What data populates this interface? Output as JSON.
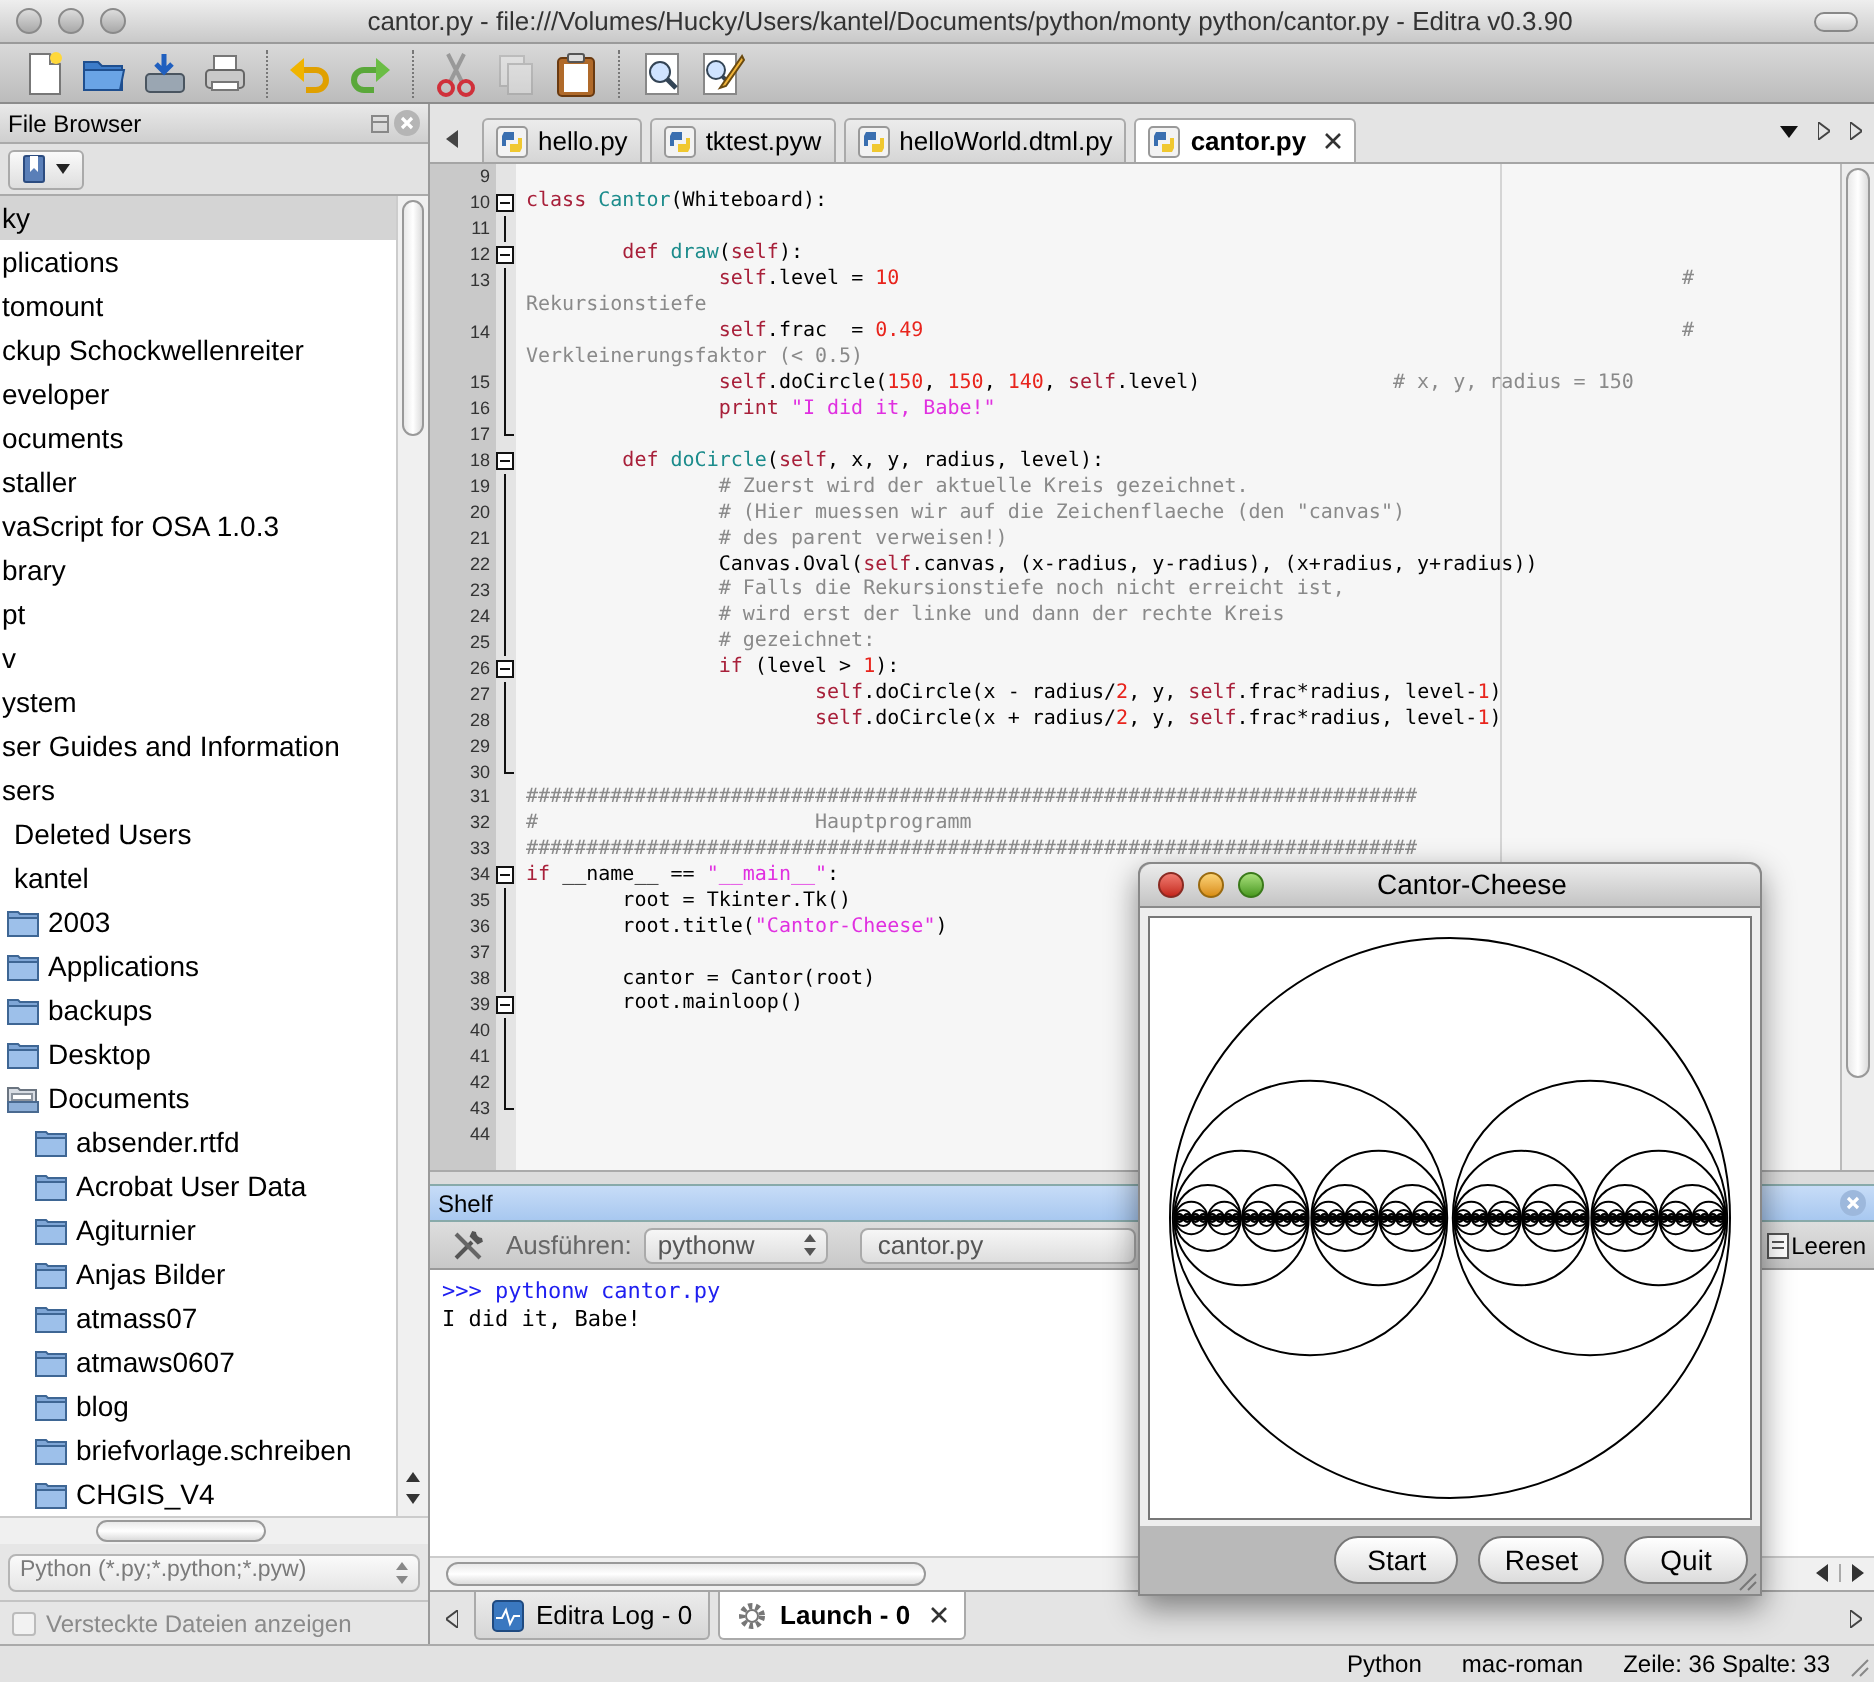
{
  "window": {
    "title": "cantor.py - file:///Volumes/Hucky/Users/kantel/Documents/python/monty python/cantor.py - Editra v0.3.90"
  },
  "toolbar": [
    [
      {
        "kind": "new",
        "disabled": false
      },
      {
        "kind": "open",
        "disabled": false
      },
      {
        "kind": "save",
        "disabled": false
      },
      {
        "kind": "print",
        "disabled": false
      }
    ],
    [
      {
        "kind": "undo",
        "disabled": false
      },
      {
        "kind": "redo",
        "disabled": false
      }
    ],
    [
      {
        "kind": "cut",
        "disabled": false
      },
      {
        "kind": "copy",
        "disabled": true
      },
      {
        "kind": "paste",
        "disabled": false
      }
    ],
    [
      {
        "kind": "find",
        "disabled": false
      },
      {
        "kind": "replace",
        "disabled": false
      }
    ]
  ],
  "file_browser": {
    "title": "File Browser",
    "tree": [
      {
        "label": "ky",
        "selected": true
      },
      {
        "label": "plications",
        "selected": false
      },
      {
        "label": "tomount",
        "selected": false
      },
      {
        "label": "ckup Schockwellenreiter",
        "selected": false
      },
      {
        "label": "eveloper",
        "selected": false
      },
      {
        "label": "ocuments",
        "selected": false
      },
      {
        "label": "staller",
        "selected": false
      },
      {
        "label": "vaScript for OSA 1.0.3",
        "selected": false
      },
      {
        "label": "brary",
        "selected": false
      },
      {
        "label": "pt",
        "selected": false
      },
      {
        "label": "v",
        "selected": false
      },
      {
        "label": "ystem",
        "selected": false
      },
      {
        "label": "ser Guides and Information",
        "selected": false
      },
      {
        "label": "sers",
        "selected": false,
        "children": [
          {
            "label": "Deleted Users",
            "selected": false
          },
          {
            "label": "kantel",
            "selected": false,
            "children": [
              {
                "label": "2003",
                "selected": false,
                "expanded": false
              },
              {
                "label": "Applications",
                "selected": false,
                "expanded": false
              },
              {
                "label": "backups",
                "selected": false,
                "expanded": false
              },
              {
                "label": "Desktop",
                "selected": false,
                "expanded": false
              },
              {
                "label": "Documents",
                "selected": false,
                "expanded": true,
                "children": [
                  {
                    "label": "absender.rtfd",
                    "selected": false,
                    "expanded": false
                  },
                  {
                    "label": "Acrobat User Data",
                    "selected": false,
                    "expanded": false
                  },
                  {
                    "label": "Agiturnier",
                    "selected": false,
                    "expanded": false
                  },
                  {
                    "label": "Anjas Bilder",
                    "selected": false,
                    "expanded": false
                  },
                  {
                    "label": "atmass07",
                    "selected": false,
                    "expanded": false
                  },
                  {
                    "label": "atmaws0607",
                    "selected": false,
                    "expanded": false
                  },
                  {
                    "label": "blog",
                    "selected": false,
                    "expanded": false
                  },
                  {
                    "label": "briefvorlage.schreiben",
                    "selected": false,
                    "expanded": false
                  },
                  {
                    "label": "CHGIS_V4",
                    "selected": false,
                    "expanded": false
                  }
                ]
              }
            ]
          }
        ]
      }
    ],
    "filter": "Python (*.py;*.python;*.pyw)",
    "hidden_files": {
      "label": "Versteckte Dateien anzeigen",
      "checked": false,
      "disabled": true
    }
  },
  "editor": {
    "tabs": [
      {
        "label": "hello.py",
        "selected": false
      },
      {
        "label": "tktest.pyw",
        "selected": false
      },
      {
        "label": "helloWorld.dtml.py",
        "selected": false
      },
      {
        "label": "cantor.py",
        "selected": true
      }
    ],
    "lines": [
      {
        "number": "9",
        "foldable": false,
        "fold_end": false,
        "in_fold": false
      },
      {
        "number": "10",
        "foldable": true,
        "fold_end": false,
        "in_fold": false,
        "tokens": [
          {
            "kind": "keyword",
            "text": "class"
          },
          {
            "kind": "name",
            "text": " Cantor"
          },
          {
            "kind": "plain",
            "text": "(Whiteboard):"
          }
        ]
      },
      {
        "number": "11",
        "foldable": false,
        "fold_end": false,
        "in_fold": true
      },
      {
        "number": "12",
        "foldable": true,
        "fold_end": false,
        "in_fold": false,
        "tokens": [
          {
            "kind": "keyword",
            "text": "\tdef"
          },
          {
            "kind": "name",
            "text": " draw"
          },
          {
            "kind": "plain",
            "text": "("
          },
          {
            "kind": "keyword",
            "text": "self"
          },
          {
            "kind": "plain",
            "text": "):"
          }
        ]
      },
      {
        "number": "13",
        "foldable": false,
        "fold_end": false,
        "in_fold": true,
        "tokens": [
          {
            "kind": "keyword",
            "text": "\t\tself"
          },
          {
            "kind": "plain",
            "text": ".level = "
          },
          {
            "kind": "number",
            "text": "10"
          },
          {
            "kind": "comment",
            "text": "\t\t\t\t\t\t\t\t\t#"
          }
        ]
      },
      {
        "foldable": false,
        "fold_end": false,
        "in_fold": true,
        "tokens": [
          {
            "kind": "comment",
            "text": "Rekursionstiefe"
          }
        ]
      },
      {
        "number": "14",
        "foldable": false,
        "fold_end": false,
        "in_fold": true,
        "tokens": [
          {
            "kind": "keyword",
            "text": "\t\tself"
          },
          {
            "kind": "plain",
            "text": ".frac  = "
          },
          {
            "kind": "number",
            "text": "0.49"
          },
          {
            "kind": "comment",
            "text": "\t\t\t\t\t\t\t\t#"
          }
        ]
      },
      {
        "foldable": false,
        "fold_end": false,
        "in_fold": true,
        "tokens": [
          {
            "kind": "comment",
            "text": "Verkleinerungsfaktor (< 0.5)"
          }
        ]
      },
      {
        "number": "15",
        "foldable": false,
        "fold_end": false,
        "in_fold": true,
        "tokens": [
          {
            "kind": "keyword",
            "text": "\t\tself"
          },
          {
            "kind": "plain",
            "text": ".doCircle("
          },
          {
            "kind": "number",
            "text": "150"
          },
          {
            "kind": "plain",
            "text": ", "
          },
          {
            "kind": "number",
            "text": "150"
          },
          {
            "kind": "plain",
            "text": ", "
          },
          {
            "kind": "number",
            "text": "140"
          },
          {
            "kind": "plain",
            "text": ", "
          },
          {
            "kind": "keyword",
            "text": "self"
          },
          {
            "kind": "plain",
            "text": ".level)"
          },
          {
            "kind": "comment",
            "text": "\t\t# x, y, radius = 150"
          }
        ]
      },
      {
        "number": "16",
        "foldable": false,
        "fold_end": false,
        "in_fold": true,
        "tokens": [
          {
            "kind": "keyword",
            "text": "\t\tprint"
          },
          {
            "kind": "string",
            "text": " \"I did it, Babe!\""
          }
        ]
      },
      {
        "number": "17",
        "foldable": false,
        "fold_end": true,
        "in_fold": false
      },
      {
        "number": "18",
        "foldable": true,
        "fold_end": false,
        "in_fold": false,
        "tokens": [
          {
            "kind": "keyword",
            "text": "\tdef"
          },
          {
            "kind": "name",
            "text": " doCircle"
          },
          {
            "kind": "plain",
            "text": "("
          },
          {
            "kind": "keyword",
            "text": "self"
          },
          {
            "kind": "plain",
            "text": ", x, y, radius, level):"
          }
        ]
      },
      {
        "number": "19",
        "foldable": false,
        "fold_end": false,
        "in_fold": true,
        "tokens": [
          {
            "kind": "comment",
            "text": "\t\t# Zuerst wird der aktuelle Kreis gezeichnet."
          }
        ]
      },
      {
        "number": "20",
        "foldable": false,
        "fold_end": false,
        "in_fold": true,
        "tokens": [
          {
            "kind": "comment",
            "text": "\t\t# (Hier muessen wir auf die Zeichenflaeche (den \"canvas\")"
          }
        ]
      },
      {
        "number": "21",
        "foldable": false,
        "fold_end": false,
        "in_fold": true,
        "tokens": [
          {
            "kind": "comment",
            "text": "\t\t# des parent verweisen!)"
          }
        ]
      },
      {
        "number": "22",
        "foldable": false,
        "fold_end": false,
        "in_fold": true,
        "tokens": [
          {
            "kind": "plain",
            "text": "\t\tCanvas.Oval("
          },
          {
            "kind": "keyword",
            "text": "self"
          },
          {
            "kind": "plain",
            "text": ".canvas, (x-radius, y-radius), (x+radius, y+radius))"
          }
        ]
      },
      {
        "number": "23",
        "foldable": false,
        "fold_end": false,
        "in_fold": true,
        "tokens": [
          {
            "kind": "comment",
            "text": "\t\t# Falls die Rekursionstiefe noch nicht erreicht ist,"
          }
        ]
      },
      {
        "number": "24",
        "foldable": false,
        "fold_end": false,
        "in_fold": true,
        "tokens": [
          {
            "kind": "comment",
            "text": "\t\t# wird erst der linke und dann der rechte Kreis"
          }
        ]
      },
      {
        "number": "25",
        "foldable": false,
        "fold_end": false,
        "in_fold": true,
        "tokens": [
          {
            "kind": "comment",
            "text": "\t\t# gezeichnet:"
          }
        ]
      },
      {
        "number": "26",
        "foldable": true,
        "fold_end": false,
        "in_fold": false,
        "tokens": [
          {
            "kind": "keyword",
            "text": "\t\tif"
          },
          {
            "kind": "plain",
            "text": " (level > "
          },
          {
            "kind": "number",
            "text": "1"
          },
          {
            "kind": "plain",
            "text": "):"
          }
        ]
      },
      {
        "number": "27",
        "foldable": false,
        "fold_end": false,
        "in_fold": true,
        "tokens": [
          {
            "kind": "keyword",
            "text": "\t\t\tself"
          },
          {
            "kind": "plain",
            "text": ".doCircle(x - radius/"
          },
          {
            "kind": "number",
            "text": "2"
          },
          {
            "kind": "plain",
            "text": ", y, "
          },
          {
            "kind": "keyword",
            "text": "self"
          },
          {
            "kind": "plain",
            "text": ".frac*radius, level-"
          },
          {
            "kind": "number",
            "text": "1"
          },
          {
            "kind": "plain",
            "text": ")"
          }
        ]
      },
      {
        "number": "28",
        "foldable": false,
        "fold_end": false,
        "in_fold": true,
        "tokens": [
          {
            "kind": "keyword",
            "text": "\t\t\tself"
          },
          {
            "kind": "plain",
            "text": ".doCircle(x + radius/"
          },
          {
            "kind": "number",
            "text": "2"
          },
          {
            "kind": "plain",
            "text": ", y, "
          },
          {
            "kind": "keyword",
            "text": "self"
          },
          {
            "kind": "plain",
            "text": ".frac*radius, level-"
          },
          {
            "kind": "number",
            "text": "1"
          },
          {
            "kind": "plain",
            "text": ")"
          }
        ]
      },
      {
        "number": "29",
        "foldable": false,
        "fold_end": false,
        "in_fold": true
      },
      {
        "number": "30",
        "foldable": false,
        "fold_end": true,
        "in_fold": false
      },
      {
        "number": "31",
        "foldable": false,
        "fold_end": false,
        "in_fold": false,
        "tokens": [
          {
            "kind": "comment",
            "text": "##########################################################################"
          }
        ]
      },
      {
        "number": "32",
        "foldable": false,
        "fold_end": false,
        "in_fold": false,
        "tokens": [
          {
            "kind": "comment",
            "text": "#\t\t\tHauptprogramm"
          }
        ]
      },
      {
        "number": "33",
        "foldable": false,
        "fold_end": false,
        "in_fold": false,
        "tokens": [
          {
            "kind": "comment",
            "text": "##########################################################################"
          }
        ]
      },
      {
        "number": "34",
        "foldable": true,
        "fold_end": false,
        "in_fold": false,
        "tokens": [
          {
            "kind": "keyword",
            "text": "if"
          },
          {
            "kind": "plain",
            "text": " __name__ == "
          },
          {
            "kind": "string",
            "text": "\"__main__\""
          },
          {
            "kind": "plain",
            "text": ":"
          }
        ]
      },
      {
        "number": "35",
        "foldable": false,
        "fold_end": false,
        "in_fold": true,
        "tokens": [
          {
            "kind": "plain",
            "text": "\troot = Tkinter.Tk()"
          }
        ]
      },
      {
        "number": "36",
        "foldable": false,
        "fold_end": false,
        "in_fold": true,
        "tokens": [
          {
            "kind": "plain",
            "text": "\troot.title("
          },
          {
            "kind": "string",
            "text": "\"Cantor-Cheese\""
          },
          {
            "kind": "plain",
            "text": ")"
          }
        ]
      },
      {
        "number": "37",
        "foldable": false,
        "fold_end": false,
        "in_fold": true
      },
      {
        "number": "38",
        "foldable": false,
        "fold_end": false,
        "in_fold": true,
        "tokens": [
          {
            "kind": "plain",
            "text": "\tcantor = Cantor(root)"
          }
        ]
      },
      {
        "number": "39",
        "foldable": true,
        "fold_end": false,
        "in_fold": false,
        "tokens": [
          {
            "kind": "plain",
            "text": "\troot.mainloop()"
          }
        ]
      },
      {
        "number": "40",
        "foldable": false,
        "fold_end": false,
        "in_fold": true
      },
      {
        "number": "41",
        "foldable": false,
        "fold_end": false,
        "in_fold": true
      },
      {
        "number": "42",
        "foldable": false,
        "fold_end": false,
        "in_fold": true
      },
      {
        "number": "43",
        "foldable": false,
        "fold_end": true,
        "in_fold": false
      },
      {
        "number": "44",
        "foldable": false,
        "fold_end": false,
        "in_fold": false
      }
    ]
  },
  "shelf": {
    "title": "Shelf",
    "run_label": "Ausführen:",
    "interpreter": "pythonw",
    "script": "cantor.py",
    "clear_button": "Leeren",
    "output": [
      {
        "kind": "command",
        "text": ">>> pythonw cantor.py"
      },
      {
        "kind": "output",
        "text": "I did it, Babe!"
      }
    ],
    "tabs": [
      {
        "kind": "log",
        "label": "Editra Log - 0",
        "selected": false
      },
      {
        "kind": "launch",
        "label": "Launch - 0",
        "selected": true
      }
    ]
  },
  "status_bar": [
    "Python",
    "mac-roman",
    "Zeile: 36 Spalte: 33"
  ],
  "app_window": {
    "title": "Cantor-Cheese",
    "buttons": [
      "Start",
      "Reset",
      "Quit"
    ]
  }
}
